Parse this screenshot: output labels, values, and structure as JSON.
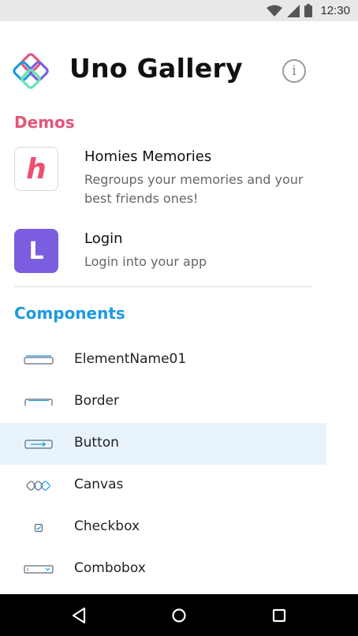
{
  "status_bar": {
    "time": "12:30",
    "icons": [
      "wifi-icon",
      "cellular-signal-icon",
      "battery-icon"
    ]
  },
  "header": {
    "title": "Uno Gallery",
    "logo": "uno-logo",
    "info_icon": "info-icon",
    "info_glyph": "i"
  },
  "demos": {
    "section_title": "Demos",
    "items": [
      {
        "title": "Homies Memories",
        "description": "Regroups your memories and your best friends ones!",
        "icon_letter": "h",
        "icon_color": "#ec4f70"
      },
      {
        "title": "Login",
        "description": "Login into your app",
        "icon_letter": "L",
        "icon_color": "#7b5ee0"
      }
    ]
  },
  "components": {
    "section_title": "Components",
    "items": [
      {
        "label": "ElementName01",
        "icon": "element-name-icon",
        "selected": false
      },
      {
        "label": "Border",
        "icon": "border-icon",
        "selected": false
      },
      {
        "label": "Button",
        "icon": "button-icon",
        "selected": true
      },
      {
        "label": "Canvas",
        "icon": "canvas-icon",
        "selected": false
      },
      {
        "label": "Checkbox",
        "icon": "checkbox-icon",
        "selected": false
      },
      {
        "label": "Combobox",
        "icon": "combobox-icon",
        "selected": false
      }
    ]
  },
  "nav_bar": {
    "buttons": [
      "back-icon",
      "home-icon",
      "recents-icon"
    ]
  },
  "colors": {
    "demos_accent": "#e5557a",
    "components_accent": "#1e9ae0",
    "selected_row": "#e8f3fc"
  }
}
